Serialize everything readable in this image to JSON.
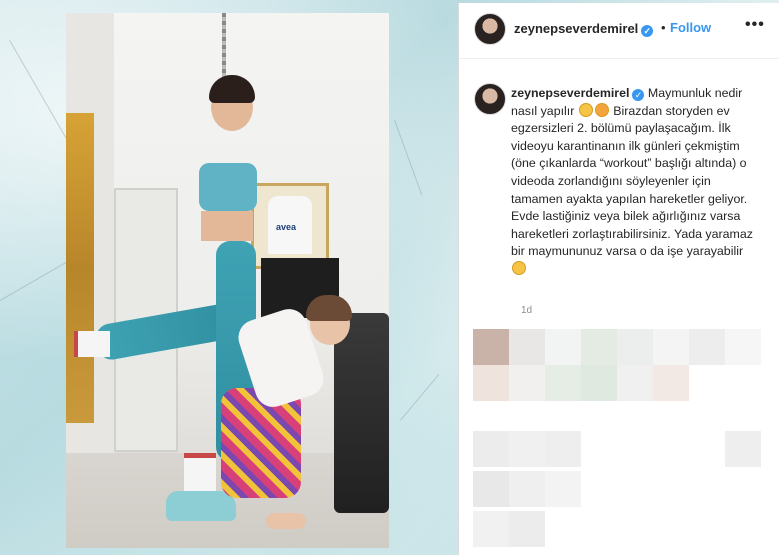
{
  "post": {
    "username": "zeynepseverdemirel",
    "verified_mark": "✓",
    "separator": "•",
    "follow_label": "Follow",
    "more_label": "•••",
    "caption": {
      "username": "zeynepseverdemirel",
      "part1": " Maymunluk nedir nasıl yapılır ",
      "part2": " Birazdan storyden ev egzersizleri 2. bölümü paylaşacağım. İlk videoyu karantinanın ilk günleri çekmiştim (öne çıkanlarda “workout” başlığı altında) o videoda zorlandığını söyleyenler için tamamen ayakta yapılan hareketler geliyor. Evde lastiğiniz veya bilek ağırlığınız varsa hareketleri zorlaştırabilirsiniz. Yada yaramaz bir maymununuz varsa o da işe yarayabilir ",
      "emoji_after_part1": [
        "grinning-sweat-emoji",
        "hugging-emoji"
      ],
      "emoji_end": "grimace-emoji"
    },
    "timestamp": "1d"
  },
  "photo": {
    "poster_text": "avea"
  },
  "colors": {
    "accent": "#3897f0",
    "text": "#262626",
    "muted": "#8e8e8e"
  }
}
